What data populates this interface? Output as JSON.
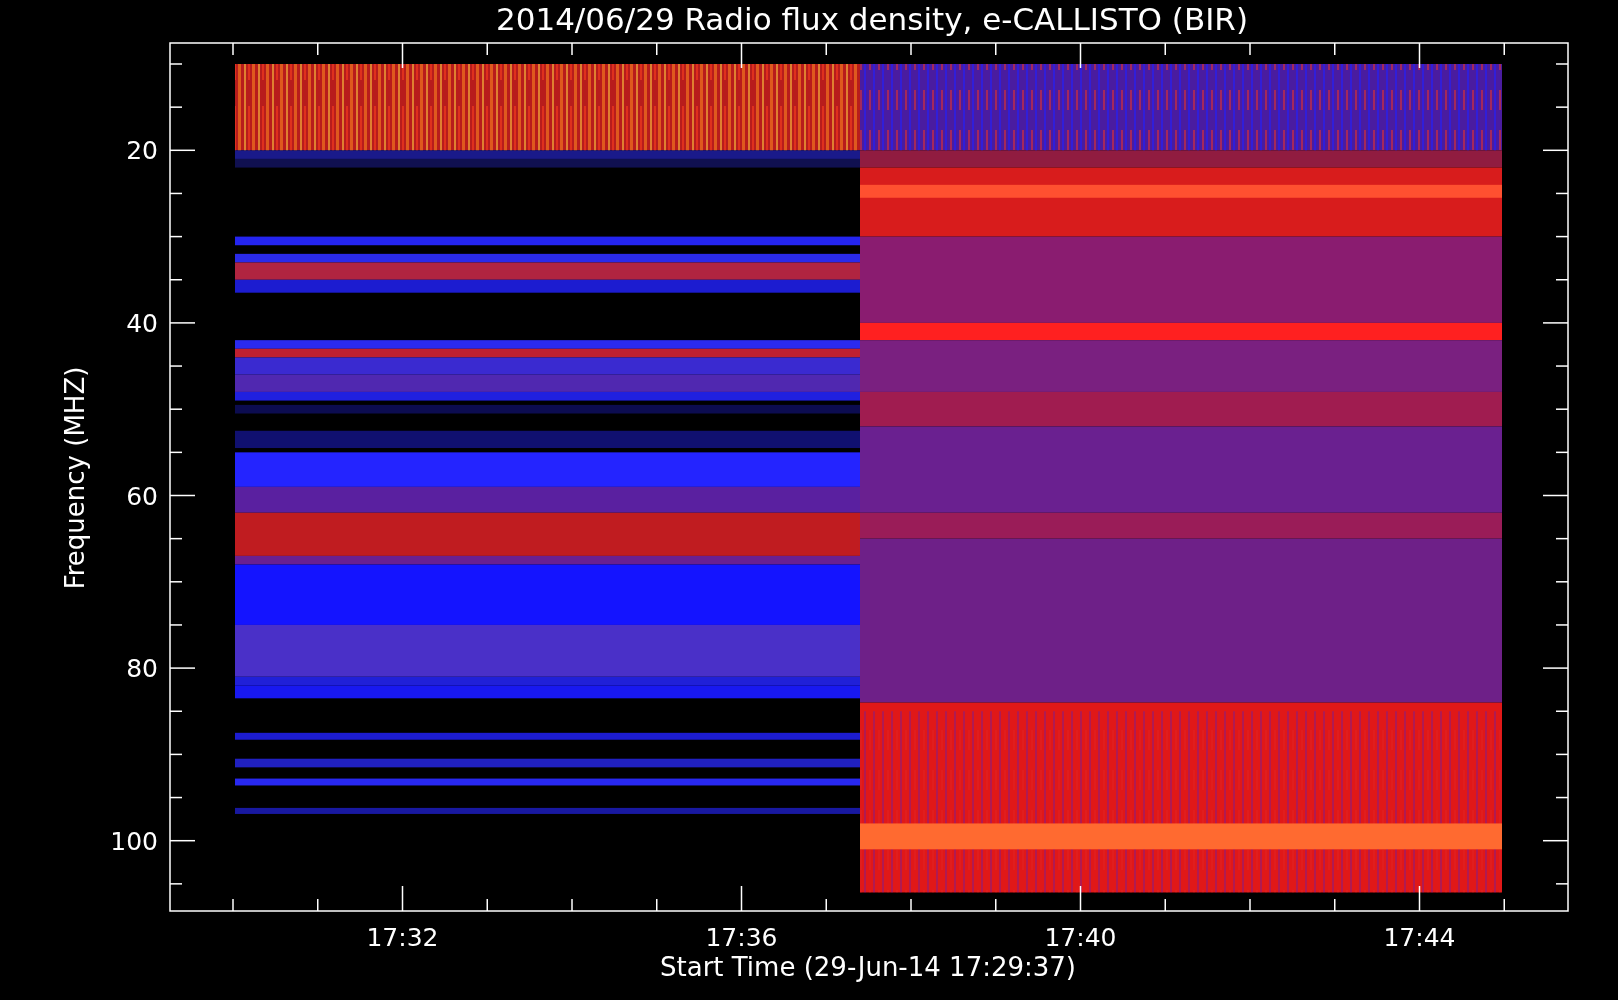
{
  "title": "2014/06/29  Radio flux density, e-CALLISTO (BIR)",
  "y_axis": {
    "label": "Frequency (MHZ)",
    "ticks": [
      "20",
      "40",
      "60",
      "80",
      "100"
    ]
  },
  "x_axis": {
    "label": "Start Time (29-Jun-14 17:29:37)",
    "ticks": [
      "17:32",
      "17:36",
      "17:40",
      "17:44"
    ]
  }
}
